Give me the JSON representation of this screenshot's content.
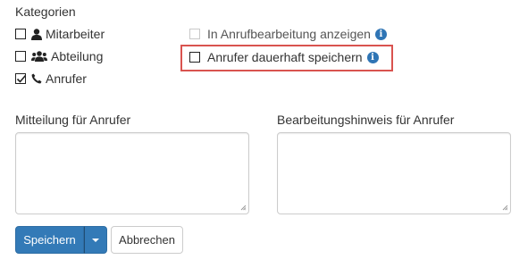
{
  "categories": {
    "label": "Kategorien",
    "items": [
      {
        "label": "Mitarbeiter",
        "checked": false,
        "icon": "user-icon"
      },
      {
        "label": "Abteilung",
        "checked": false,
        "icon": "users-icon"
      },
      {
        "label": "Anrufer",
        "checked": true,
        "icon": "phone-icon"
      }
    ]
  },
  "options": {
    "show_in_processing": {
      "label": "In Anrufbearbeitung anzeigen",
      "checked": false,
      "disabled": true,
      "icon": "info-icon"
    },
    "save_caller_permanently": {
      "label": "Anrufer dauerhaft speichern",
      "checked": false,
      "disabled": false,
      "icon": "info-icon"
    }
  },
  "message_field": {
    "label": "Mitteilung für Anrufer",
    "value": ""
  },
  "note_field": {
    "label": "Bearbeitungshinweis für Anrufer",
    "value": ""
  },
  "buttons": {
    "save_label": "Speichern",
    "cancel_label": "Abbrechen"
  },
  "colors": {
    "primary": "#337ab7",
    "highlight": "#d9534f",
    "info": "#2f75b5"
  }
}
